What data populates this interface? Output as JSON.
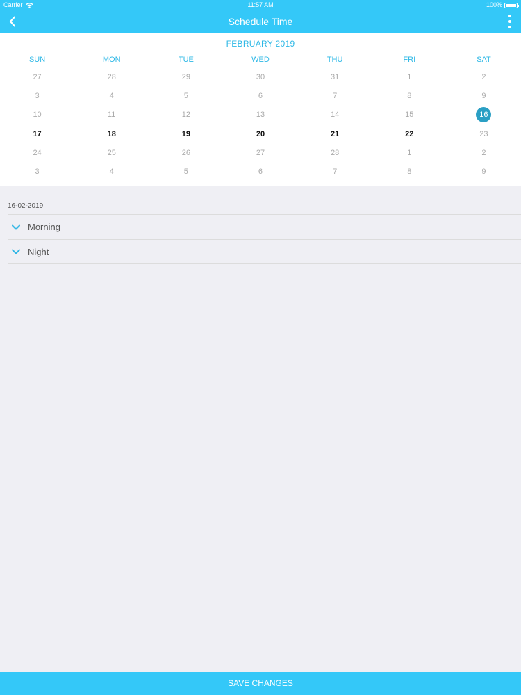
{
  "status_bar": {
    "carrier": "Carrier",
    "time": "11:57 AM",
    "battery": "100%"
  },
  "nav": {
    "title": "Schedule Time"
  },
  "calendar": {
    "month": "FEBRUARY 2019",
    "weekdays": [
      "SUN",
      "MON",
      "TUE",
      "WED",
      "THU",
      "FRI",
      "SAT"
    ],
    "weeks": [
      [
        {
          "d": "27",
          "s": "muted"
        },
        {
          "d": "28",
          "s": "muted"
        },
        {
          "d": "29",
          "s": "muted"
        },
        {
          "d": "30",
          "s": "muted"
        },
        {
          "d": "31",
          "s": "muted"
        },
        {
          "d": "1",
          "s": "muted"
        },
        {
          "d": "2",
          "s": "muted"
        }
      ],
      [
        {
          "d": "3",
          "s": "muted"
        },
        {
          "d": "4",
          "s": "muted"
        },
        {
          "d": "5",
          "s": "muted"
        },
        {
          "d": "6",
          "s": "muted"
        },
        {
          "d": "7",
          "s": "muted"
        },
        {
          "d": "8",
          "s": "muted"
        },
        {
          "d": "9",
          "s": "muted"
        }
      ],
      [
        {
          "d": "10",
          "s": "muted"
        },
        {
          "d": "11",
          "s": "muted"
        },
        {
          "d": "12",
          "s": "muted"
        },
        {
          "d": "13",
          "s": "muted"
        },
        {
          "d": "14",
          "s": "muted"
        },
        {
          "d": "15",
          "s": "muted"
        },
        {
          "d": "16",
          "s": "selected"
        }
      ],
      [
        {
          "d": "17",
          "s": "active"
        },
        {
          "d": "18",
          "s": "active"
        },
        {
          "d": "19",
          "s": "active"
        },
        {
          "d": "20",
          "s": "active"
        },
        {
          "d": "21",
          "s": "active"
        },
        {
          "d": "22",
          "s": "active"
        },
        {
          "d": "23",
          "s": "muted"
        }
      ],
      [
        {
          "d": "24",
          "s": "muted"
        },
        {
          "d": "25",
          "s": "muted"
        },
        {
          "d": "26",
          "s": "muted"
        },
        {
          "d": "27",
          "s": "muted"
        },
        {
          "d": "28",
          "s": "muted"
        },
        {
          "d": "1",
          "s": "muted"
        },
        {
          "d": "2",
          "s": "muted"
        }
      ],
      [
        {
          "d": "3",
          "s": "muted"
        },
        {
          "d": "4",
          "s": "muted"
        },
        {
          "d": "5",
          "s": "muted"
        },
        {
          "d": "6",
          "s": "muted"
        },
        {
          "d": "7",
          "s": "muted"
        },
        {
          "d": "8",
          "s": "muted"
        },
        {
          "d": "9",
          "s": "muted"
        }
      ]
    ]
  },
  "schedule": {
    "selected_date": "16-02-2019",
    "sections": [
      {
        "label": "Morning",
        "icon": "chevron-down-icon"
      },
      {
        "label": "Night",
        "icon": "chevron-down-icon"
      }
    ]
  },
  "footer": {
    "save_label": "SAVE CHANGES"
  },
  "colors": {
    "accent": "#34c8f8",
    "selected_day": "#2a9fc4",
    "weekday_text": "#2eb8e6",
    "background": "#efeff4"
  }
}
